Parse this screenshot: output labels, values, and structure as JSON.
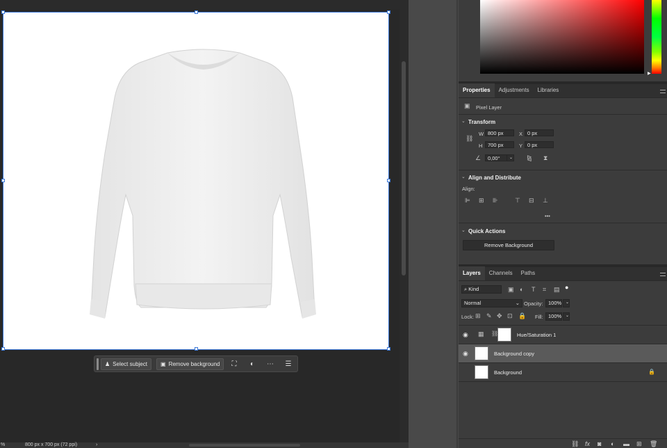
{
  "status": {
    "zoom_fragment": "%",
    "doc_info": "800 px x 700 px (72 ppi)",
    "arrow": "›"
  },
  "taskbar": {
    "select_subject": "Select subject",
    "remove_background": "Remove background",
    "icons": [
      "person-icon",
      "image-icon",
      "crop-icon",
      "half-circle-icon",
      "more-icon",
      "sliders-icon"
    ]
  },
  "properties": {
    "tabs": [
      "Properties",
      "Adjustments",
      "Libraries"
    ],
    "active_tab": "Properties",
    "layer_kind": "Pixel Layer",
    "transform": {
      "heading": "Transform",
      "w_label": "W",
      "w_value": "800 px",
      "x_label": "X",
      "x_value": "0 px",
      "h_label": "H",
      "h_value": "700 px",
      "y_label": "Y",
      "y_value": "0 px",
      "angle": "0,00°"
    },
    "align": {
      "heading": "Align and Distribute",
      "label": "Align:",
      "more": "•••"
    },
    "quick_actions": {
      "heading": "Quick Actions",
      "button": "Remove Background"
    }
  },
  "layers": {
    "tabs": [
      "Layers",
      "Channels",
      "Paths"
    ],
    "active_tab": "Layers",
    "filter_kind": "Kind",
    "blend_mode": "Normal",
    "opacity_label": "Opacity:",
    "opacity_value": "100%",
    "lock_label": "Lock:",
    "fill_label": "Fill:",
    "fill_value": "100%",
    "items": [
      {
        "name": "Hue/Saturation 1",
        "visible": true,
        "selected": false
      },
      {
        "name": "Background copy",
        "visible": true,
        "selected": true
      },
      {
        "name": "Background",
        "visible": false,
        "selected": false,
        "locked": true
      }
    ]
  },
  "colors": {
    "selection": "#3c78d8",
    "panel": "#3c3c3c",
    "canvas_bg": "#282828"
  }
}
